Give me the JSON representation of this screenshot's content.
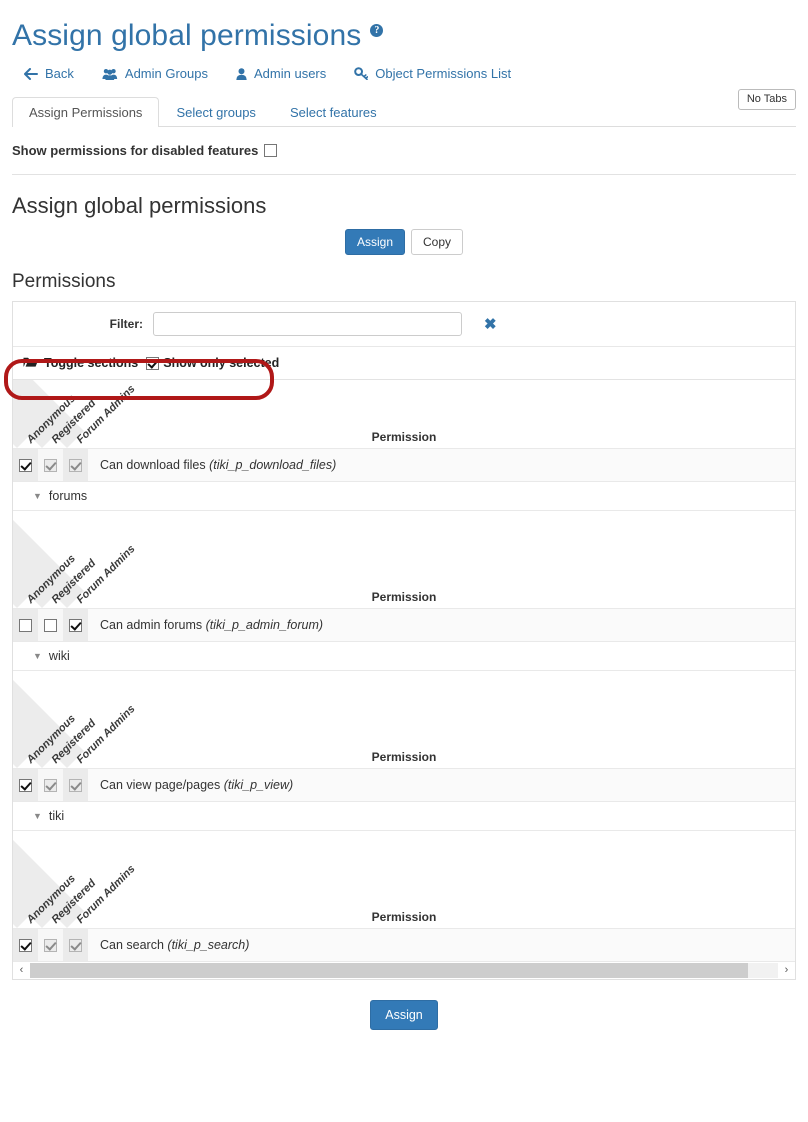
{
  "header": {
    "title": "Assign global permissions",
    "help_icon": "help-circle-icon",
    "actions": [
      {
        "label": "Back",
        "icon": "arrow-left-icon",
        "glyph": "←"
      },
      {
        "label": "Admin Groups",
        "icon": "users-group-icon",
        "glyph": "\u0001"
      },
      {
        "label": "Admin users",
        "icon": "user-icon",
        "glyph": "\u0001"
      },
      {
        "label": "Object Permissions List",
        "icon": "key-icon",
        "glyph": "\u0001"
      }
    ]
  },
  "tabs": {
    "items": [
      {
        "label": "Assign Permissions",
        "active": true
      },
      {
        "label": "Select groups",
        "active": false
      },
      {
        "label": "Select features",
        "active": false
      }
    ],
    "no_tabs_label": "No Tabs"
  },
  "options": {
    "show_disabled_label": "Show permissions for disabled features",
    "show_disabled_checked": false
  },
  "main": {
    "heading": "Assign global permissions",
    "assign_label": "Assign",
    "copy_label": "Copy",
    "permissions_heading": "Permissions",
    "bottom_assign_label": "Assign"
  },
  "filter": {
    "label": "Filter:",
    "value": "",
    "placeholder": "",
    "clear_icon": "close-x-icon",
    "clear_glyph": "✖"
  },
  "toggle": {
    "folder_icon": "folder-open-icon",
    "folder_glyph": "🗁",
    "toggle_sections_label": "Toggle sections",
    "show_only_selected_label": "Show only selected",
    "show_only_selected_checked": true,
    "highlight_color": "#b01818"
  },
  "columns": [
    "Anonymous",
    "Registered",
    "Forum Admins"
  ],
  "permission_column_label": "Permission",
  "tables": [
    {
      "section": null,
      "tall_header": false,
      "rows": [
        {
          "name": "Can download files",
          "code": "(tiki_p_download_files)",
          "checks": [
            {
              "checked": true,
              "disabled": false
            },
            {
              "checked": true,
              "disabled": true
            },
            {
              "checked": true,
              "disabled": true
            }
          ]
        }
      ]
    },
    {
      "section": "forums",
      "tall_header": true,
      "rows": [
        {
          "name": "Can admin forums",
          "code": "(tiki_p_admin_forum)",
          "checks": [
            {
              "checked": false,
              "disabled": false
            },
            {
              "checked": false,
              "disabled": false
            },
            {
              "checked": true,
              "disabled": false
            }
          ]
        }
      ]
    },
    {
      "section": "wiki",
      "tall_header": true,
      "rows": [
        {
          "name": "Can view page/pages",
          "code": "(tiki_p_view)",
          "checks": [
            {
              "checked": true,
              "disabled": false
            },
            {
              "checked": true,
              "disabled": true
            },
            {
              "checked": true,
              "disabled": true
            }
          ]
        }
      ]
    },
    {
      "section": "tiki",
      "tall_header": true,
      "rows": [
        {
          "name": "Can search",
          "code": "(tiki_p_search)",
          "checks": [
            {
              "checked": true,
              "disabled": false
            },
            {
              "checked": true,
              "disabled": true
            },
            {
              "checked": true,
              "disabled": true
            }
          ]
        }
      ]
    }
  ],
  "scrollbar": {
    "left_glyph": "‹",
    "right_glyph": "›"
  },
  "colors": {
    "link": "#3273a8",
    "primary_button": "#337ab7",
    "annotation": "#b01818"
  }
}
